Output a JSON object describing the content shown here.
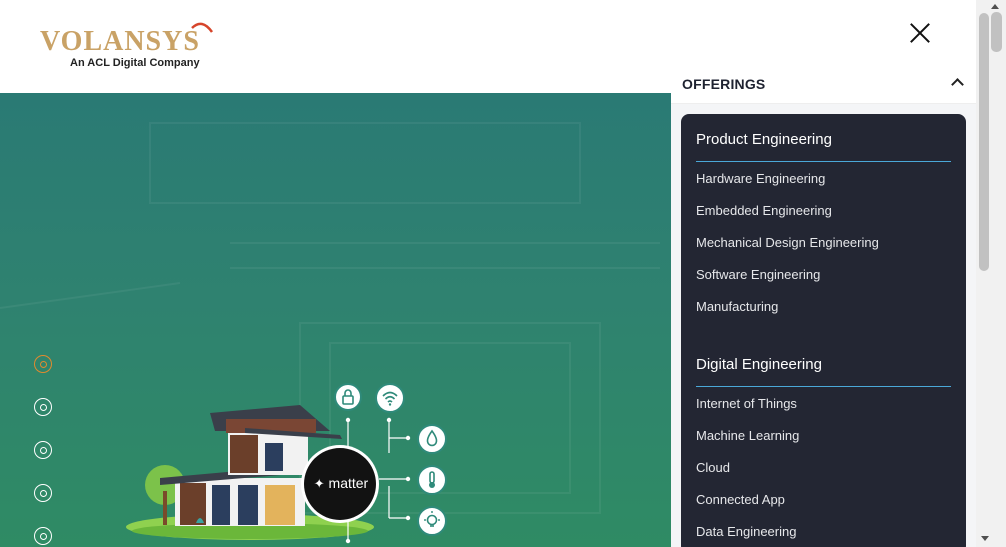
{
  "header": {
    "logo_text": "VOLANSYS",
    "logo_tagline": "An ACL Digital Company"
  },
  "hero": {
    "badge_text": "matter",
    "slider": {
      "slide_count": 5,
      "active_index": 0
    },
    "icons": [
      "lock-icon",
      "wifi-icon",
      "water-drop-icon",
      "thermometer-icon",
      "light-bulb-icon"
    ]
  },
  "drawer": {
    "offerings_label": "OFFERINGS",
    "sections": [
      {
        "title": "Product Engineering",
        "items": [
          "Hardware Engineering",
          "Embedded Engineering",
          "Mechanical Design Engineering",
          "Software Engineering",
          "Manufacturing"
        ]
      },
      {
        "title": "Digital Engineering",
        "items": [
          "Internet of Things",
          "Machine Learning",
          "Cloud",
          "Connected App",
          "Data Engineering"
        ]
      }
    ]
  },
  "colors": {
    "brand_gold": "#c9a266",
    "accent_orange": "#e08a2e",
    "menu_panel": "#232633",
    "section_rule": "#4aa8d8"
  }
}
